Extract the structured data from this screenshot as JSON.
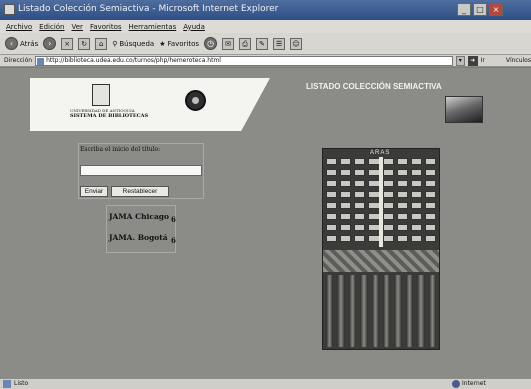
{
  "window": {
    "title": "Listado Colección Semiactiva - Microsoft Internet Explorer"
  },
  "menu": [
    "Archivo",
    "Edición",
    "Ver",
    "Favoritos",
    "Herramientas",
    "Ayuda"
  ],
  "toolbar": {
    "back_label": "Atrás",
    "search_label": "Búsqueda",
    "favorites_label": "Favoritos"
  },
  "address": {
    "label": "Dirección",
    "url": "http://biblioteca.udea.edu.co/turnos/php/hemeroteca.html",
    "go_label": "Ir",
    "links_label": "Vínculos"
  },
  "page": {
    "logo_line1": "UNIVERSIDAD DE ANTIOQUIA",
    "logo_line2": "SISTEMA DE BIBLIOTECAS",
    "title": "LISTADO COLECCIÓN SEMIACTIVA",
    "form_label": "Escriba el inicio del título:",
    "title_input_value": "",
    "send_label": "Enviar",
    "reset_label": "Restablecer",
    "results": [
      {
        "name": "JAMA Chicago",
        "count": "6"
      },
      {
        "name": "JAMA. Bogotá",
        "count": "6"
      }
    ],
    "shelf_label": "ARAS"
  },
  "status": {
    "left": "Listo",
    "right": "Internet"
  }
}
